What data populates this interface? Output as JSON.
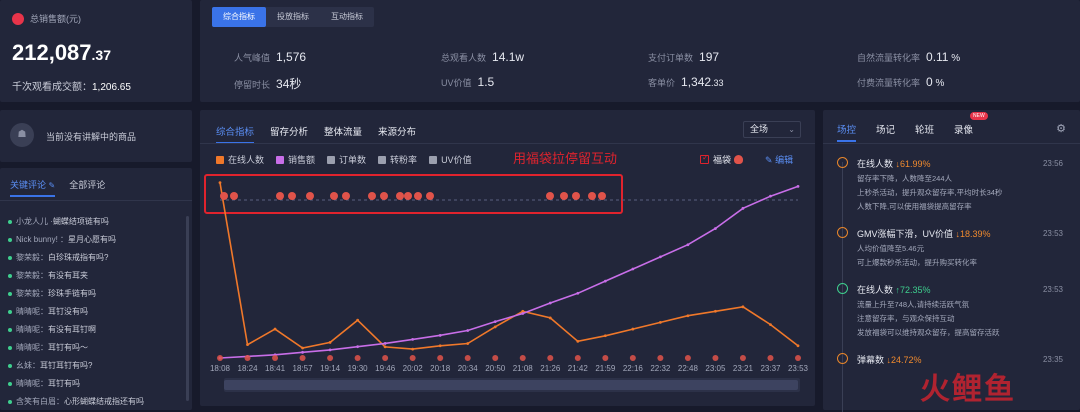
{
  "sales": {
    "label": "总销售额(元)",
    "amount_int": "212,087",
    "amount_dec": ".37",
    "gpm_label": "千次观看成交额：",
    "gpm_value": "1,206.65"
  },
  "metric_tabs": [
    {
      "label": "综合指标",
      "active": true
    },
    {
      "label": "投放指标",
      "active": false
    },
    {
      "label": "互动指标",
      "active": false
    }
  ],
  "metrics": [
    {
      "label": "人气峰值",
      "value": "1,576",
      "dec": ""
    },
    {
      "label": "总观看人数",
      "value": "14.1w",
      "dec": ""
    },
    {
      "label": "支付订单数",
      "value": "197",
      "dec": ""
    },
    {
      "label": "自然流量转化率",
      "value": "0.11",
      "dec": " %"
    },
    {
      "label": "停留时长",
      "value": "34秒",
      "dec": ""
    },
    {
      "label": "UV价值",
      "value": "1.5",
      "dec": ""
    },
    {
      "label": "客单价",
      "value": "1,342",
      "dec": ".33"
    },
    {
      "label": "付费流量转化率",
      "value": "0",
      "dec": " %"
    }
  ],
  "product_panel": {
    "empty_text": "当前没有讲解中的商品"
  },
  "comments": {
    "tabs": [
      "关键评论",
      "全部评论"
    ],
    "items": [
      {
        "name": "小龙人儿 ·",
        "text": "蝴蝶结项链有吗"
      },
      {
        "name": "Nick bunny! ：",
        "text": "星月心愿有吗"
      },
      {
        "name": "黎荣毅：",
        "text": "白珍珠戒指有吗?"
      },
      {
        "name": "黎荣毅：",
        "text": "有没有耳夹"
      },
      {
        "name": "黎荣毅：",
        "text": "珍珠手链有吗"
      },
      {
        "name": "晴晴呢：",
        "text": "耳钉没有吗"
      },
      {
        "name": "晴晴呢：",
        "text": "有没有耳钉啊"
      },
      {
        "name": "晴晴呢：",
        "text": "耳钉有吗～"
      },
      {
        "name": "幺妹：",
        "text": "耳钉耳钉有吗?"
      },
      {
        "name": "晴晴呢：",
        "text": "耳钉有吗"
      },
      {
        "name": "含笑有白眉：",
        "text": "心形蝴蝶结戒指还有吗"
      }
    ]
  },
  "chart_tabs": [
    "综合指标",
    "留存分析",
    "整体流量",
    "来源分布"
  ],
  "scope_select": "全场",
  "legend": [
    {
      "label": "在线人数",
      "color": "#f0782a",
      "checked": true
    },
    {
      "label": "销售额",
      "color": "#c86ee8",
      "checked": true
    },
    {
      "label": "订单数",
      "color": "#9b9fae",
      "checked": false
    },
    {
      "label": "转粉率",
      "color": "#9b9fae",
      "checked": false
    },
    {
      "label": "UV价值",
      "color": "#9b9fae",
      "checked": false
    }
  ],
  "annotation": "用福袋拉停留互动",
  "fudai_label": "福袋",
  "edit_label": "编辑",
  "colors": {
    "online": "#f0782a",
    "sales": "#c86ee8",
    "accent": "#3a73e8",
    "annotation": "#e0232d"
  },
  "chart_data": {
    "type": "line",
    "x": [
      "18:08",
      "18:24",
      "18:41",
      "18:57",
      "19:14",
      "19:30",
      "19:46",
      "20:02",
      "20:18",
      "20:34",
      "20:50",
      "21:08",
      "21:26",
      "21:42",
      "21:59",
      "22:16",
      "22:32",
      "22:48",
      "23:05",
      "23:21",
      "23:37",
      "23:53"
    ],
    "series": [
      {
        "name": "在线人数",
        "values": [
          1576,
          120,
          260,
          90,
          140,
          340,
          100,
          80,
          110,
          130,
          280,
          420,
          360,
          150,
          200,
          260,
          320,
          380,
          420,
          460,
          300,
          110
        ]
      },
      {
        "name": "销售额",
        "values": [
          0,
          2000,
          4000,
          7000,
          10000,
          14000,
          18000,
          23000,
          28000,
          34000,
          45000,
          55000,
          68000,
          80000,
          95000,
          110000,
          125000,
          140000,
          160000,
          185000,
          200000,
          212087
        ]
      }
    ],
    "ylim_online": [
      0,
      1600
    ],
    "ylim_sales": [
      0,
      220000
    ],
    "grid": false,
    "legend": "top-left"
  },
  "side_tabs": [
    {
      "label": "场控",
      "active": true
    },
    {
      "label": "场记",
      "active": false
    },
    {
      "label": "轮班",
      "active": false
    },
    {
      "label": "录像",
      "active": false,
      "badge": "NEW"
    }
  ],
  "events": [
    {
      "title": "在线人数",
      "change": "↓61.99%",
      "dir": "down",
      "time": "23:56",
      "lines": [
        "留存率下降，人数降至244人",
        "上秒杀活动，提升观众留存率,平均时长34秒",
        "人数下降,可以使用福袋提高留存率"
      ]
    },
    {
      "title": "GMV涨幅下滑，UV价值",
      "change": "↓18.39%",
      "dir": "down",
      "time": "23:53",
      "lines": [
        "人均价值降至5.46元",
        "可上爆款秒杀活动，提升购买转化率"
      ]
    },
    {
      "title": "在线人数",
      "change": "↑72.35%",
      "dir": "up",
      "time": "23:53",
      "lines": [
        "流量上升至748人,请持续活跃气氛",
        "注意留存率，与观众保持互动",
        "发放福袋可以维持观众留存，提高留存活跃"
      ]
    },
    {
      "title": "弹幕数",
      "change": "↓24.72%",
      "dir": "down",
      "time": "23:35",
      "lines": []
    }
  ],
  "watermark": "火鲤鱼"
}
